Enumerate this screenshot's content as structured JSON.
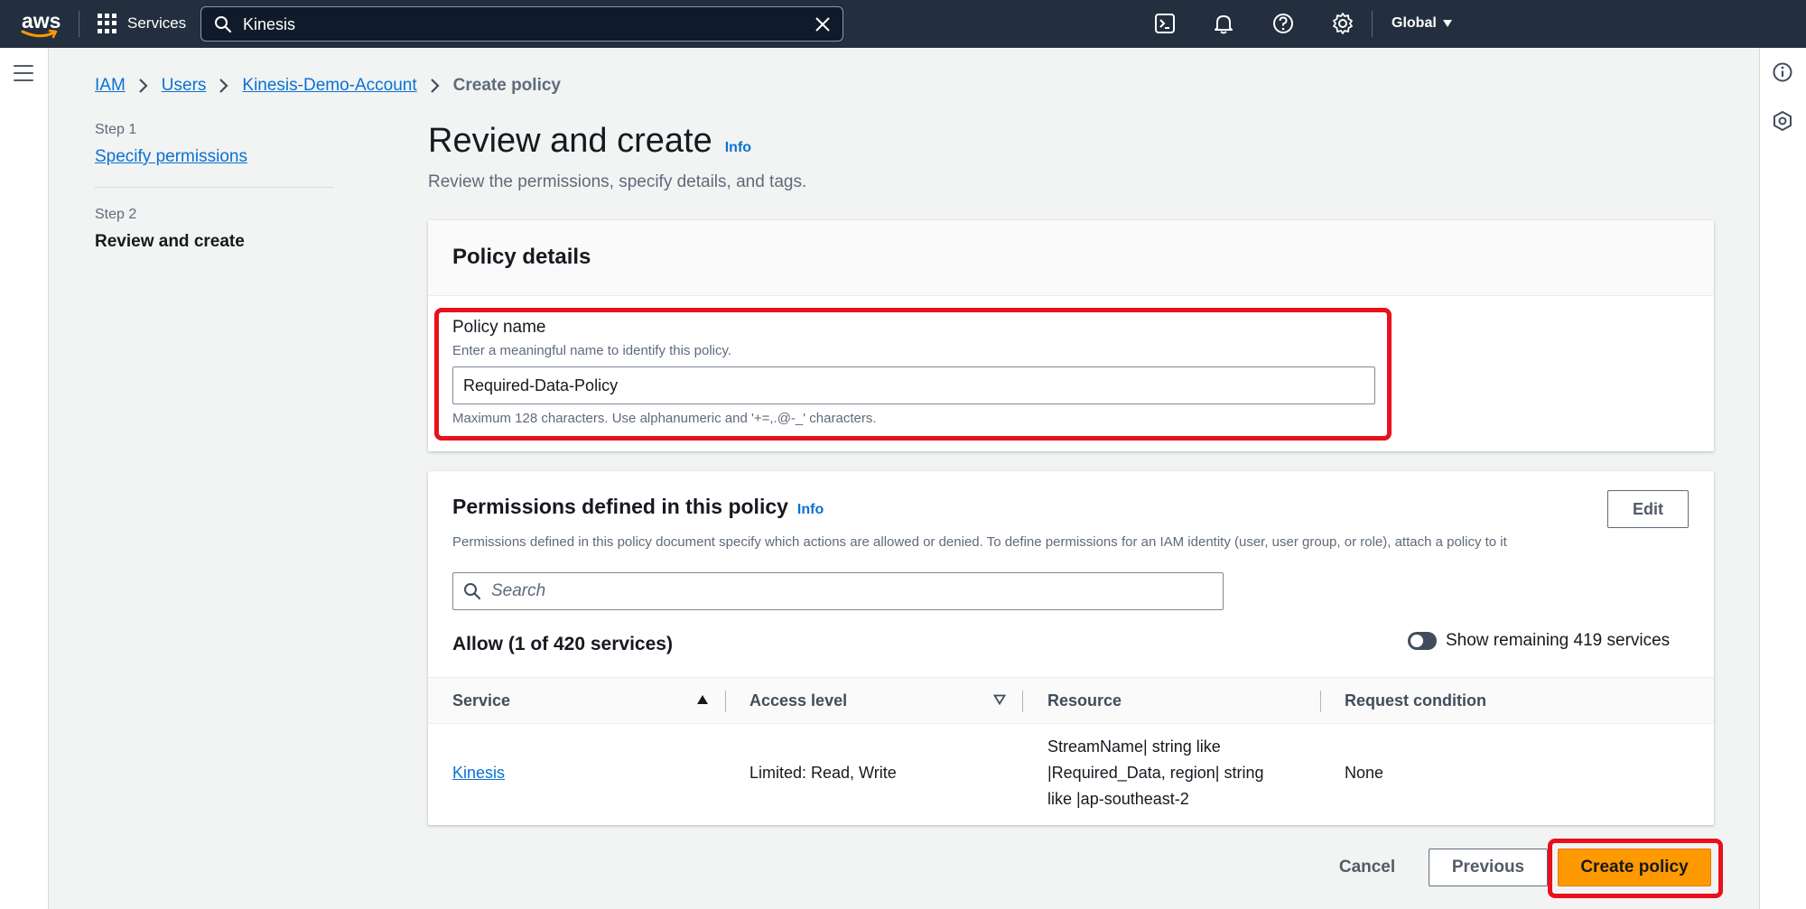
{
  "topnav": {
    "logo_text": "aws",
    "services_label": "Services",
    "search_value": "Kinesis",
    "region_label": "Global",
    "icons": [
      "cloudshell-icon",
      "bell-icon",
      "help-icon",
      "settings-icon"
    ]
  },
  "breadcrumb": {
    "items": [
      "IAM",
      "Users",
      "Kinesis-Demo-Account"
    ],
    "current": "Create policy"
  },
  "steps": {
    "step1_label": "Step 1",
    "step1_link": "Specify permissions",
    "step2_label": "Step 2",
    "step2_current": "Review and create"
  },
  "page": {
    "title": "Review and create",
    "info_label": "Info",
    "subtitle": "Review the permissions, specify details, and tags."
  },
  "policy_details": {
    "heading": "Policy details",
    "name_label": "Policy name",
    "name_description": "Enter a meaningful name to identify this policy.",
    "name_value": "Required-Data-Policy",
    "name_hint": "Maximum 128 characters. Use alphanumeric and '+=,.@-_' characters."
  },
  "permissions": {
    "heading": "Permissions defined in this policy",
    "info_label": "Info",
    "edit_label": "Edit",
    "description": "Permissions defined in this policy document specify which actions are allowed or denied. To define permissions for an IAM identity (user, user group, or role), attach a policy to it",
    "search_placeholder": "Search",
    "allow_summary": "Allow (1 of 420 services)",
    "toggle_label": "Show remaining 419 services",
    "toggle_on": false,
    "columns": [
      "Service",
      "Access level",
      "Resource",
      "Request condition"
    ],
    "rows": [
      {
        "service": "Kinesis",
        "access_level": "Limited: Read, Write",
        "resource_lines": [
          "StreamName| string like",
          "|Required_Data, region| string",
          "like |ap-southeast-2"
        ],
        "request_condition": "None"
      }
    ]
  },
  "actions": {
    "cancel": "Cancel",
    "previous": "Previous",
    "create": "Create policy"
  },
  "colors": {
    "nav_bg": "#232f3e",
    "link": "#0972d3",
    "primary_button": "#ff9900",
    "highlight_box": "#e8111c"
  }
}
